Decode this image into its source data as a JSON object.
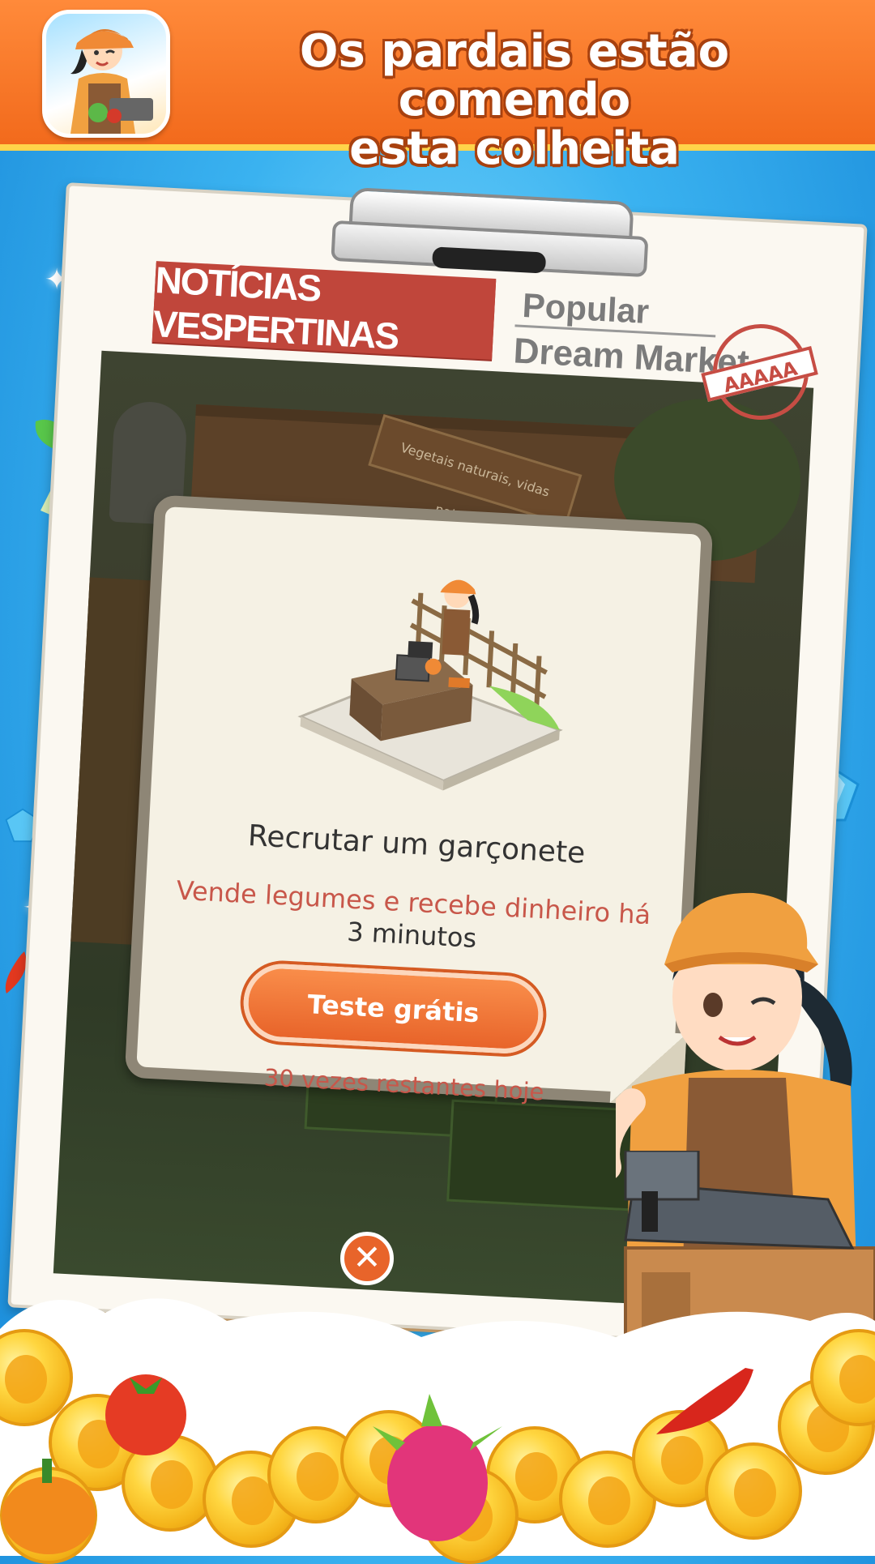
{
  "banner": {
    "title_line1": "Os pardais estão comendo",
    "title_line2": "esta colheita",
    "app_icon": "farmer-girl-app-icon"
  },
  "newspaper": {
    "headline": "NOTÍCIAS VESPERTINAS",
    "side_line1": "Popular",
    "side_line2": "Dream Market",
    "stamp": "AAAAA"
  },
  "scene": {
    "sign_text": "Vegetais naturais, vidas naturais"
  },
  "dialog": {
    "title": "Recrutar um garçonete",
    "desc_part1": "Vende legumes e recebe dinheiro há ",
    "desc_highlight": "3 minutos",
    "button_label": "Teste grátis",
    "remaining": "30 vezes restantes hoje"
  },
  "close": {
    "symbol": "✕"
  },
  "colors": {
    "banner_orange": "#f26a1c",
    "accent_red": "#c0463b",
    "button_orange": "#e8642a",
    "sky_blue": "#3ab2f0",
    "coin_gold": "#ffd640"
  }
}
